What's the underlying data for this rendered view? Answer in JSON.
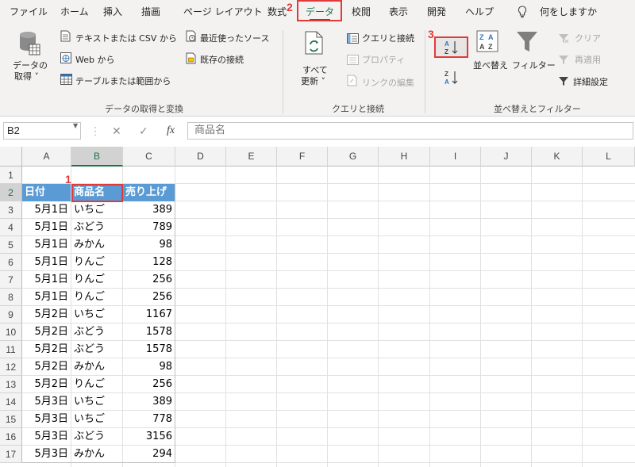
{
  "tabs": [
    {
      "label": "ファイル"
    },
    {
      "label": "ホーム"
    },
    {
      "label": "挿入"
    },
    {
      "label": "描画"
    },
    {
      "label": "ページ レイアウト"
    },
    {
      "label": "数式"
    },
    {
      "label": "データ"
    },
    {
      "label": "校閲"
    },
    {
      "label": "表示"
    },
    {
      "label": "開発"
    },
    {
      "label": "ヘルプ"
    },
    {
      "label": "何をしますか"
    }
  ],
  "markers": {
    "one": "1",
    "two": "2",
    "three": "3"
  },
  "ribbon": {
    "get_data": {
      "line1": "データの",
      "line2": "取得 ˅"
    },
    "from_text_csv": "テキストまたは CSV から",
    "from_web": "Web から",
    "from_table": "テーブルまたは範囲から",
    "recent_sources": "最近使ったソース",
    "existing_connections": "既存の接続",
    "group_get_transform": "データの取得と変換",
    "refresh_all": {
      "line1": "すべて",
      "line2": "更新 ˅"
    },
    "queries_connections": "クエリと接続",
    "properties": "プロパティ",
    "edit_links": "リンクの編集",
    "group_queries": "クエリと接続",
    "sort": "並べ替え",
    "filter": "フィルター",
    "clear": "クリア",
    "reapply": "再適用",
    "advanced": "詳細設定",
    "group_sort_filter": "並べ替えとフィルター",
    "sort_az_icon": "sort-ascending-icon",
    "sort_za_icon": "sort-descending-icon"
  },
  "formula_bar": {
    "name_box": "B2",
    "cancel": "✕",
    "enter": "✓",
    "fx": "fx",
    "formula": "商品名"
  },
  "sheet": {
    "columns": [
      "A",
      "B",
      "C",
      "D",
      "E",
      "F",
      "G",
      "H",
      "I",
      "J",
      "K",
      "L"
    ],
    "rows": [
      "1",
      "2",
      "3",
      "4",
      "5",
      "6",
      "7",
      "8",
      "9",
      "10",
      "11",
      "12",
      "13",
      "14",
      "15",
      "16",
      "17"
    ],
    "headers": [
      "日付",
      "商品名",
      "売り上げ"
    ],
    "data": [
      [
        "5月1日",
        "いちご",
        "389"
      ],
      [
        "5月1日",
        "ぶどう",
        "789"
      ],
      [
        "5月1日",
        "みかん",
        "98"
      ],
      [
        "5月1日",
        "りんご",
        "128"
      ],
      [
        "5月1日",
        "りんご",
        "256"
      ],
      [
        "5月1日",
        "りんご",
        "256"
      ],
      [
        "5月2日",
        "いちご",
        "1167"
      ],
      [
        "5月2日",
        "ぶどう",
        "1578"
      ],
      [
        "5月2日",
        "ぶどう",
        "1578"
      ],
      [
        "5月2日",
        "みかん",
        "98"
      ],
      [
        "5月2日",
        "りんご",
        "256"
      ],
      [
        "5月3日",
        "いちご",
        "389"
      ],
      [
        "5月3日",
        "いちご",
        "778"
      ],
      [
        "5月3日",
        "ぶどう",
        "3156"
      ],
      [
        "5月3日",
        "みかん",
        "294"
      ]
    ]
  },
  "colors": {
    "accent": "#217346",
    "header_fill": "#5b9bd5",
    "annotation": "#e03a3a"
  }
}
